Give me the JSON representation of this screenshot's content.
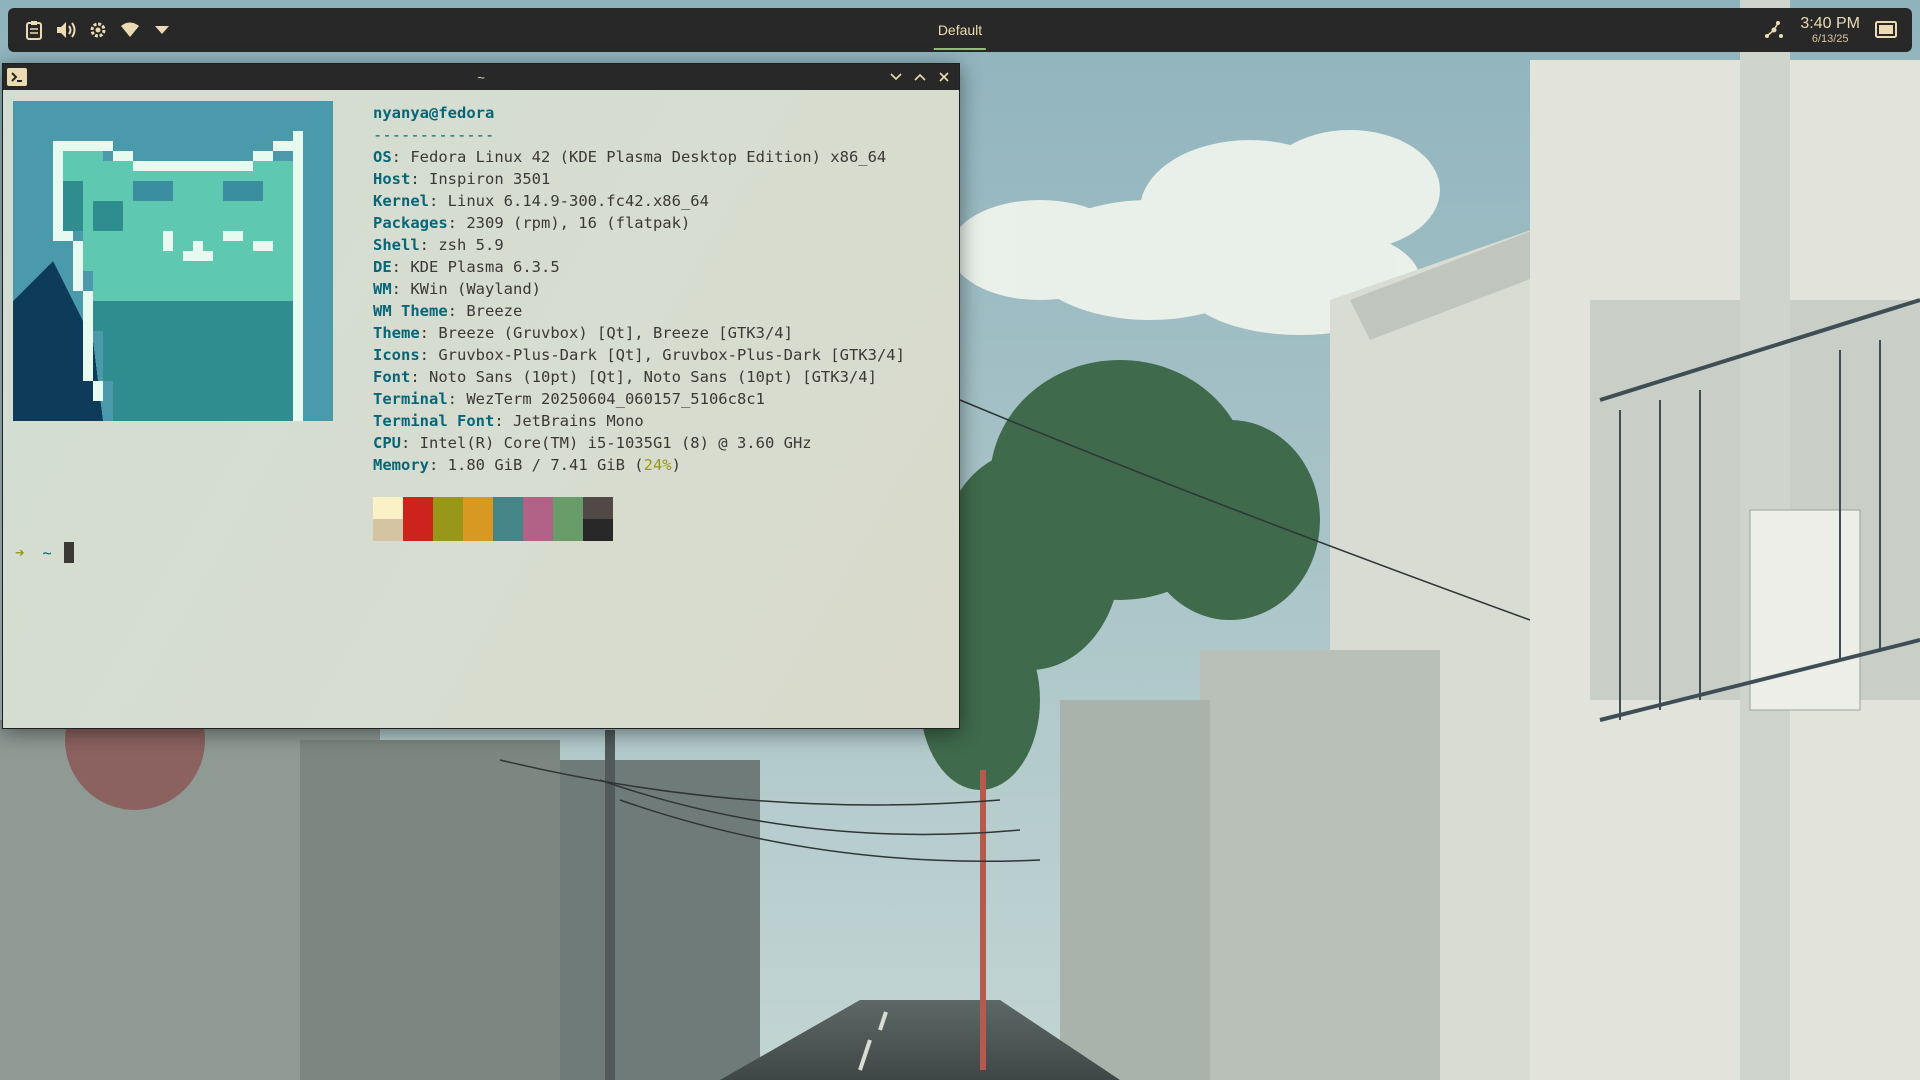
{
  "panel": {
    "tray_icons": [
      "clipboard-icon",
      "volume-icon",
      "settings-icon",
      "wifi-icon",
      "tray-expand-icon"
    ],
    "activity_label": "Default",
    "clock": {
      "time": "3:40 PM",
      "date": "6/13/25"
    },
    "right_icons": [
      "network-status-icon",
      "show-desktop-icon"
    ]
  },
  "window": {
    "title": "~",
    "app_icon": "terminal-icon",
    "controls": [
      "minimize-icon",
      "maximize-icon",
      "close-icon"
    ]
  },
  "fetch": {
    "user": "nyanya@fedora",
    "separator": "-------------",
    "lines": [
      {
        "key": "OS",
        "value": "Fedora Linux 42 (KDE Plasma Desktop Edition) x86_64"
      },
      {
        "key": "Host",
        "value": "Inspiron 3501"
      },
      {
        "key": "Kernel",
        "value": "Linux 6.14.9-300.fc42.x86_64"
      },
      {
        "key": "Packages",
        "value": "2309 (rpm), 16 (flatpak)"
      },
      {
        "key": "Shell",
        "value": "zsh 5.9"
      },
      {
        "key": "DE",
        "value": "KDE Plasma 6.3.5"
      },
      {
        "key": "WM",
        "value": "KWin (Wayland)"
      },
      {
        "key": "WM Theme",
        "value": "Breeze"
      },
      {
        "key": "Theme",
        "value": "Breeze (Gruvbox) [Qt], Breeze [GTK3/4]"
      },
      {
        "key": "Icons",
        "value": "Gruvbox-Plus-Dark [Qt], Gruvbox-Plus-Dark [GTK3/4]"
      },
      {
        "key": "Font",
        "value": "Noto Sans (10pt) [Qt], Noto Sans (10pt) [GTK3/4]"
      },
      {
        "key": "Terminal",
        "value": "WezTerm 20250604_060157_5106c8c1"
      },
      {
        "key": "Terminal Font",
        "value": "JetBrains Mono"
      },
      {
        "key": "CPU",
        "value": "Intel(R) Core(TM) i5-1035G1 (8) @ 3.60 GHz"
      }
    ],
    "memory": {
      "key": "Memory",
      "value": "1.80 GiB / 7.41 GiB (",
      "percent": "24%",
      "close": ")"
    },
    "palette_top": [
      "#fbf1c7",
      "#cc241d",
      "#98971a",
      "#d79921",
      "#458588",
      "#b16286",
      "#689d6a",
      "#504945"
    ],
    "palette_bottom": [
      "#d5c4a1",
      "#cc241d",
      "#98971a",
      "#d79921",
      "#458588",
      "#b16286",
      "#689d6a",
      "#282828"
    ]
  },
  "prompt": {
    "arrow": "➜",
    "path": "~"
  },
  "colors": {
    "panel_bg": "#282828",
    "accent": "#8ec07c",
    "term_bg": "#d5dcd0"
  }
}
